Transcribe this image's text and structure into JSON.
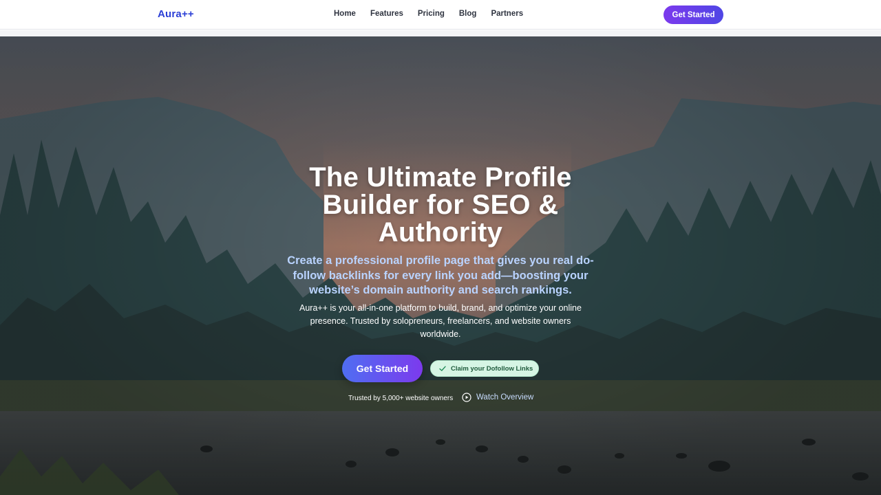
{
  "nav": {
    "brand": "Aura++",
    "links": [
      "Home",
      "Features",
      "Pricing",
      "Blog",
      "Partners"
    ],
    "cta": "Get Started"
  },
  "hero": {
    "title_lines": [
      "The Ultimate Profile",
      "Builder for SEO &",
      "Authority"
    ],
    "subtitle": "Create a professional profile page that gives you real do-follow backlinks for every link you add—boosting your website’s domain authority and search rankings.",
    "description": "Aura++ is your all-in-one platform to build, brand, and optimize your online presence. Trusted by solopreneurs, freelancers, and website owners worldwide.",
    "cta": "Get Started",
    "badge": "Claim your Dofollow Links",
    "trusted": "Trusted by 5,000+ website owners",
    "watch": "Watch Overview"
  },
  "icons": {
    "badge": "check-icon",
    "watch": "play-circle-icon"
  },
  "colors": {
    "brand": "#2b3fd6",
    "cta_start": "#7c3aed",
    "cta_end": "#4f46e5",
    "subtitle": "#b9d3ff",
    "badge_bg": "#d6f5e4"
  }
}
